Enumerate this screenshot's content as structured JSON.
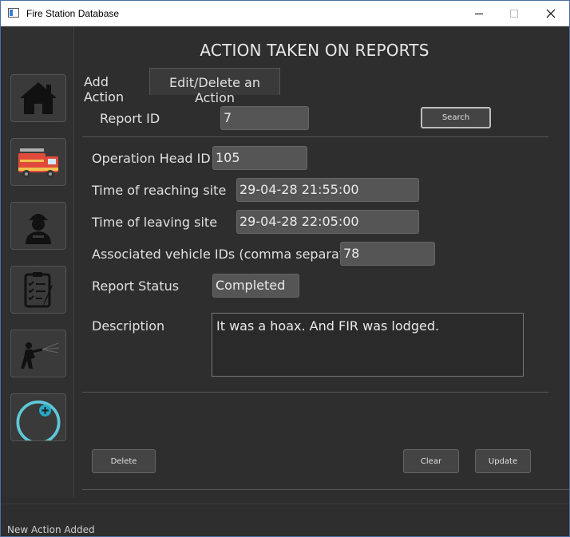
{
  "window": {
    "title": "Fire Station Database"
  },
  "sidebar": {
    "items": [
      {
        "icon": "home-icon"
      },
      {
        "icon": "fire-truck-icon"
      },
      {
        "icon": "firefighter-icon"
      },
      {
        "icon": "clipboard-report-icon"
      },
      {
        "icon": "firefighter-hose-icon"
      },
      {
        "icon": "add-circle-icon"
      }
    ]
  },
  "main": {
    "heading": "ACTION TAKEN ON REPORTS",
    "tabs": [
      {
        "label": "Add Action"
      },
      {
        "label": "Edit/Delete an Action"
      }
    ],
    "search": {
      "report_id_label": "Report ID",
      "report_id_value": "7",
      "search_label": "Search"
    },
    "form": {
      "operation_head_label": "Operation Head ID",
      "operation_head_value": "105",
      "reach_time_label": "Time of reaching site",
      "reach_time_value": "29-04-28 21:55:00",
      "leave_time_label": "Time of leaving site",
      "leave_time_value": "29-04-28 22:05:00",
      "vehicles_label": "Associated vehicle IDs (comma separated)",
      "vehicles_value": "78",
      "status_label": "Report Status",
      "status_value": "Completed",
      "description_label": "Description",
      "description_value": "It was a hoax. And FIR was lodged."
    },
    "actions": {
      "delete_label": "Delete",
      "clear_label": "Clear",
      "update_label": "Update"
    }
  },
  "statusbar": {
    "text": "New Action Added"
  },
  "colors": {
    "background": "#2e2e2e",
    "field": "#555555",
    "accent": "#5ec8d8",
    "truck_red": "#e04a3a"
  }
}
